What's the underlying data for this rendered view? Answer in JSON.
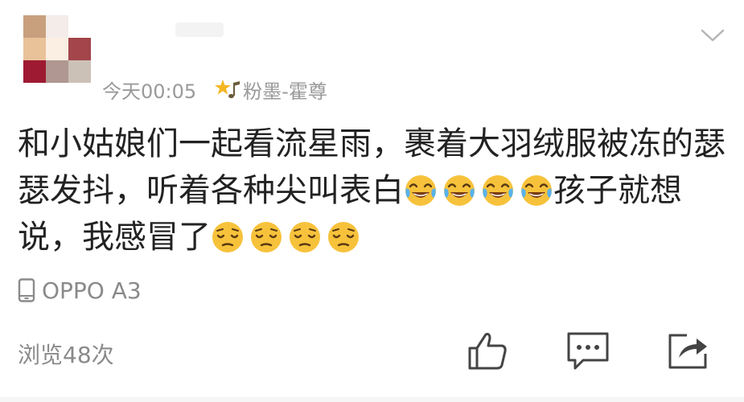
{
  "header": {
    "avatar": {
      "pixels": [
        "#c8a07e",
        "#f3ece8",
        "#ffffff",
        "#e9c29a",
        "#fbeee3",
        "#a3454a",
        "#9e1a32",
        "#b09791",
        "#ccc1b7"
      ]
    },
    "timestamp": "今天00:05",
    "badge_icon": "star-music-note-icon",
    "group_label": "粉墨-霍尊",
    "expand_icon": "chevron-down-icon"
  },
  "post": {
    "segments": [
      {
        "text": "和小姑娘们一起看流星雨，裹着大羽绒服被冻的瑟瑟发抖，听着各种尖叫表白"
      },
      {
        "emoji": "face-with-tears-of-joy-icon",
        "count": 4
      },
      {
        "text": "孩子就想说，我感冒了"
      },
      {
        "emoji": "pensive-face-icon",
        "count": 4
      }
    ]
  },
  "device": {
    "icon": "phone-icon",
    "label": "OPPO A3"
  },
  "footer": {
    "views": "浏览48次",
    "actions": [
      "like-icon",
      "comment-icon",
      "share-icon"
    ]
  },
  "colors": {
    "text": "#222222",
    "meta": "#9a9a9a",
    "icon": "#444444",
    "emoji_yellow": "#f7c23b"
  }
}
